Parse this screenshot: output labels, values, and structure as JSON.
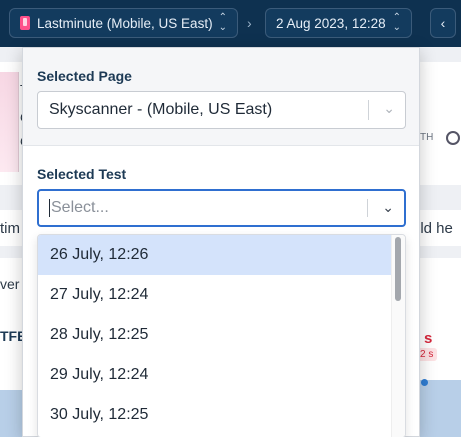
{
  "header": {
    "page_selector": "Lastminute (Mobile, US East)",
    "date_selector": "2 Aug 2023, 12:28",
    "breadcrumb_separator": "›",
    "nav_prev": "‹"
  },
  "background": {
    "frag_t": "T",
    "frag_c1": "C",
    "frag_c2": "C",
    "frag_th": "TH",
    "frag_tim": "tim",
    "frag_uld": "uld he",
    "frag_ver": "ver",
    "frag_tfb": "TFB",
    "frag_s": "s",
    "frag_2s": "2 s"
  },
  "panel": {
    "page_label": "Selected Page",
    "page_value": "Skyscanner - (Mobile, US East)",
    "test_label": "Selected Test",
    "test_placeholder": "Select...",
    "options": [
      "26 July, 12:26",
      "27 July, 12:24",
      "28 July, 12:25",
      "29 July, 12:24",
      "30 July, 12:25"
    ],
    "focused_option_index": 0
  },
  "icons": {
    "caret": "⌄",
    "updown": "⌃⌄"
  },
  "colors": {
    "header_bg": "#0e3150",
    "focus_border": "#2f6fd0",
    "option_highlight": "#d4e3fb",
    "accent_red": "#d6263b"
  }
}
